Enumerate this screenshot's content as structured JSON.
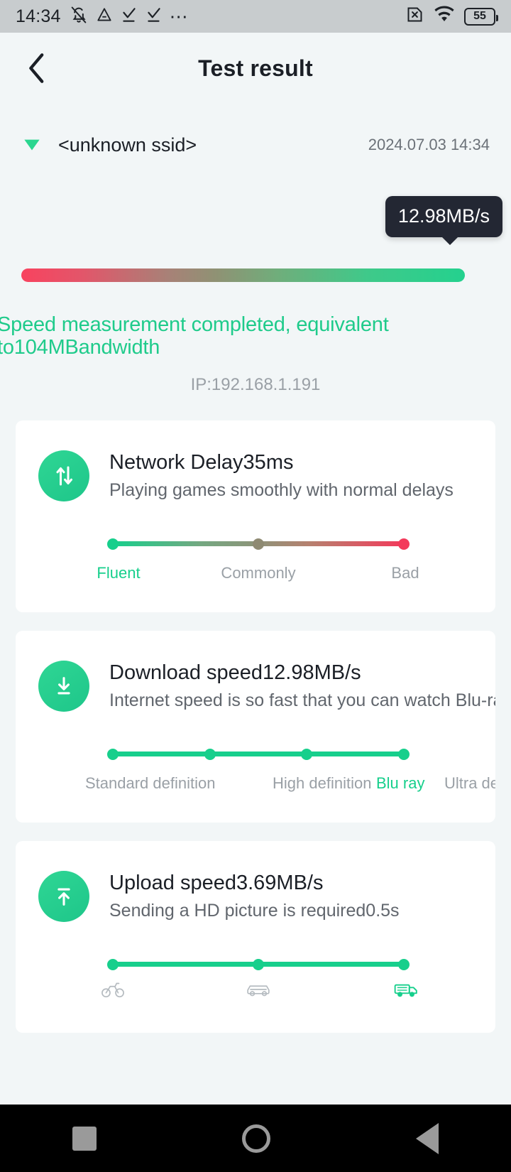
{
  "statusbar": {
    "time": "14:34",
    "battery_level": "55",
    "icons": [
      "mute-bell-icon",
      "triangle-drive-icon",
      "check-download-icon",
      "check-download-icon",
      "more-dots-icon"
    ],
    "right_icons": [
      "sim-disabled-icon",
      "wifi-icon",
      "battery-icon"
    ]
  },
  "header": {
    "back_label": "‹",
    "title": "Test result"
  },
  "network": {
    "ssid": "<unknown ssid>",
    "timestamp": "2024.07.03 14:34",
    "wifi_icon": "wifi-signal-icon"
  },
  "summary": {
    "tooltip_speed": "12.98MB/s",
    "result_text": "Speed measurement completed, equivalent to104MBandwidth",
    "ip": "IP:192.168.1.191"
  },
  "cards": [
    {
      "icon": "network-delay-icon",
      "title": "Network Delay35ms",
      "subtitle": "Playing games smoothly with normal delays",
      "track_style": "mixed",
      "dots": [
        {
          "pos": 0,
          "color": "#17cf8c"
        },
        {
          "pos": 50,
          "color": "#8e8a72"
        },
        {
          "pos": 100,
          "color": "#f33a5b"
        }
      ],
      "labels": [
        {
          "text": "Fluent",
          "pos": 0,
          "active": true
        },
        {
          "text": "Commonly",
          "pos": 50,
          "active": false
        },
        {
          "text": "Bad",
          "pos": 100,
          "active": false
        }
      ]
    },
    {
      "icon": "download-icon",
      "title": "Download speed12.98MB/s",
      "subtitle": "Internet speed is so fast that you can watch Blu-ray vi",
      "track_style": "green",
      "dots": [
        {
          "pos": 0,
          "color": "#17cf8c"
        },
        {
          "pos": 33.3,
          "color": "#17cf8c"
        },
        {
          "pos": 66.6,
          "color": "#17cf8c"
        },
        {
          "pos": 100,
          "color": "#17cf8c"
        }
      ],
      "labels": [
        {
          "text": "Standard definition",
          "pos": 0,
          "active": false
        },
        {
          "text": "High definition",
          "pos": 62,
          "active": false
        },
        {
          "text": "Blu ray",
          "pos": 100,
          "active": true
        },
        {
          "text": "Ultra defi",
          "pos": 140,
          "active": false
        }
      ]
    },
    {
      "icon": "upload-icon",
      "title": "Upload speed3.69MB/s",
      "subtitle": "Sending a HD picture is required0.5s",
      "track_style": "green",
      "dots": [
        {
          "pos": 0,
          "color": "#17cf8c"
        },
        {
          "pos": 50,
          "color": "#17cf8c"
        },
        {
          "pos": 100,
          "color": "#17cf8c"
        }
      ],
      "vehicle_icons": [
        {
          "name": "bicycle-icon",
          "pos": 0,
          "active": false
        },
        {
          "name": "car-icon",
          "pos": 50,
          "active": false
        },
        {
          "name": "truck-icon",
          "pos": 100,
          "active": true
        }
      ]
    }
  ],
  "navbar": {
    "recents_label": "recents-square-icon",
    "home_label": "home-circle-icon",
    "back_label": "back-triangle-icon"
  },
  "colors": {
    "accent_green": "#17cf8c",
    "danger_red": "#f33a5b",
    "page_bg": "#f2f6f7",
    "tooltip_bg": "#232733"
  }
}
